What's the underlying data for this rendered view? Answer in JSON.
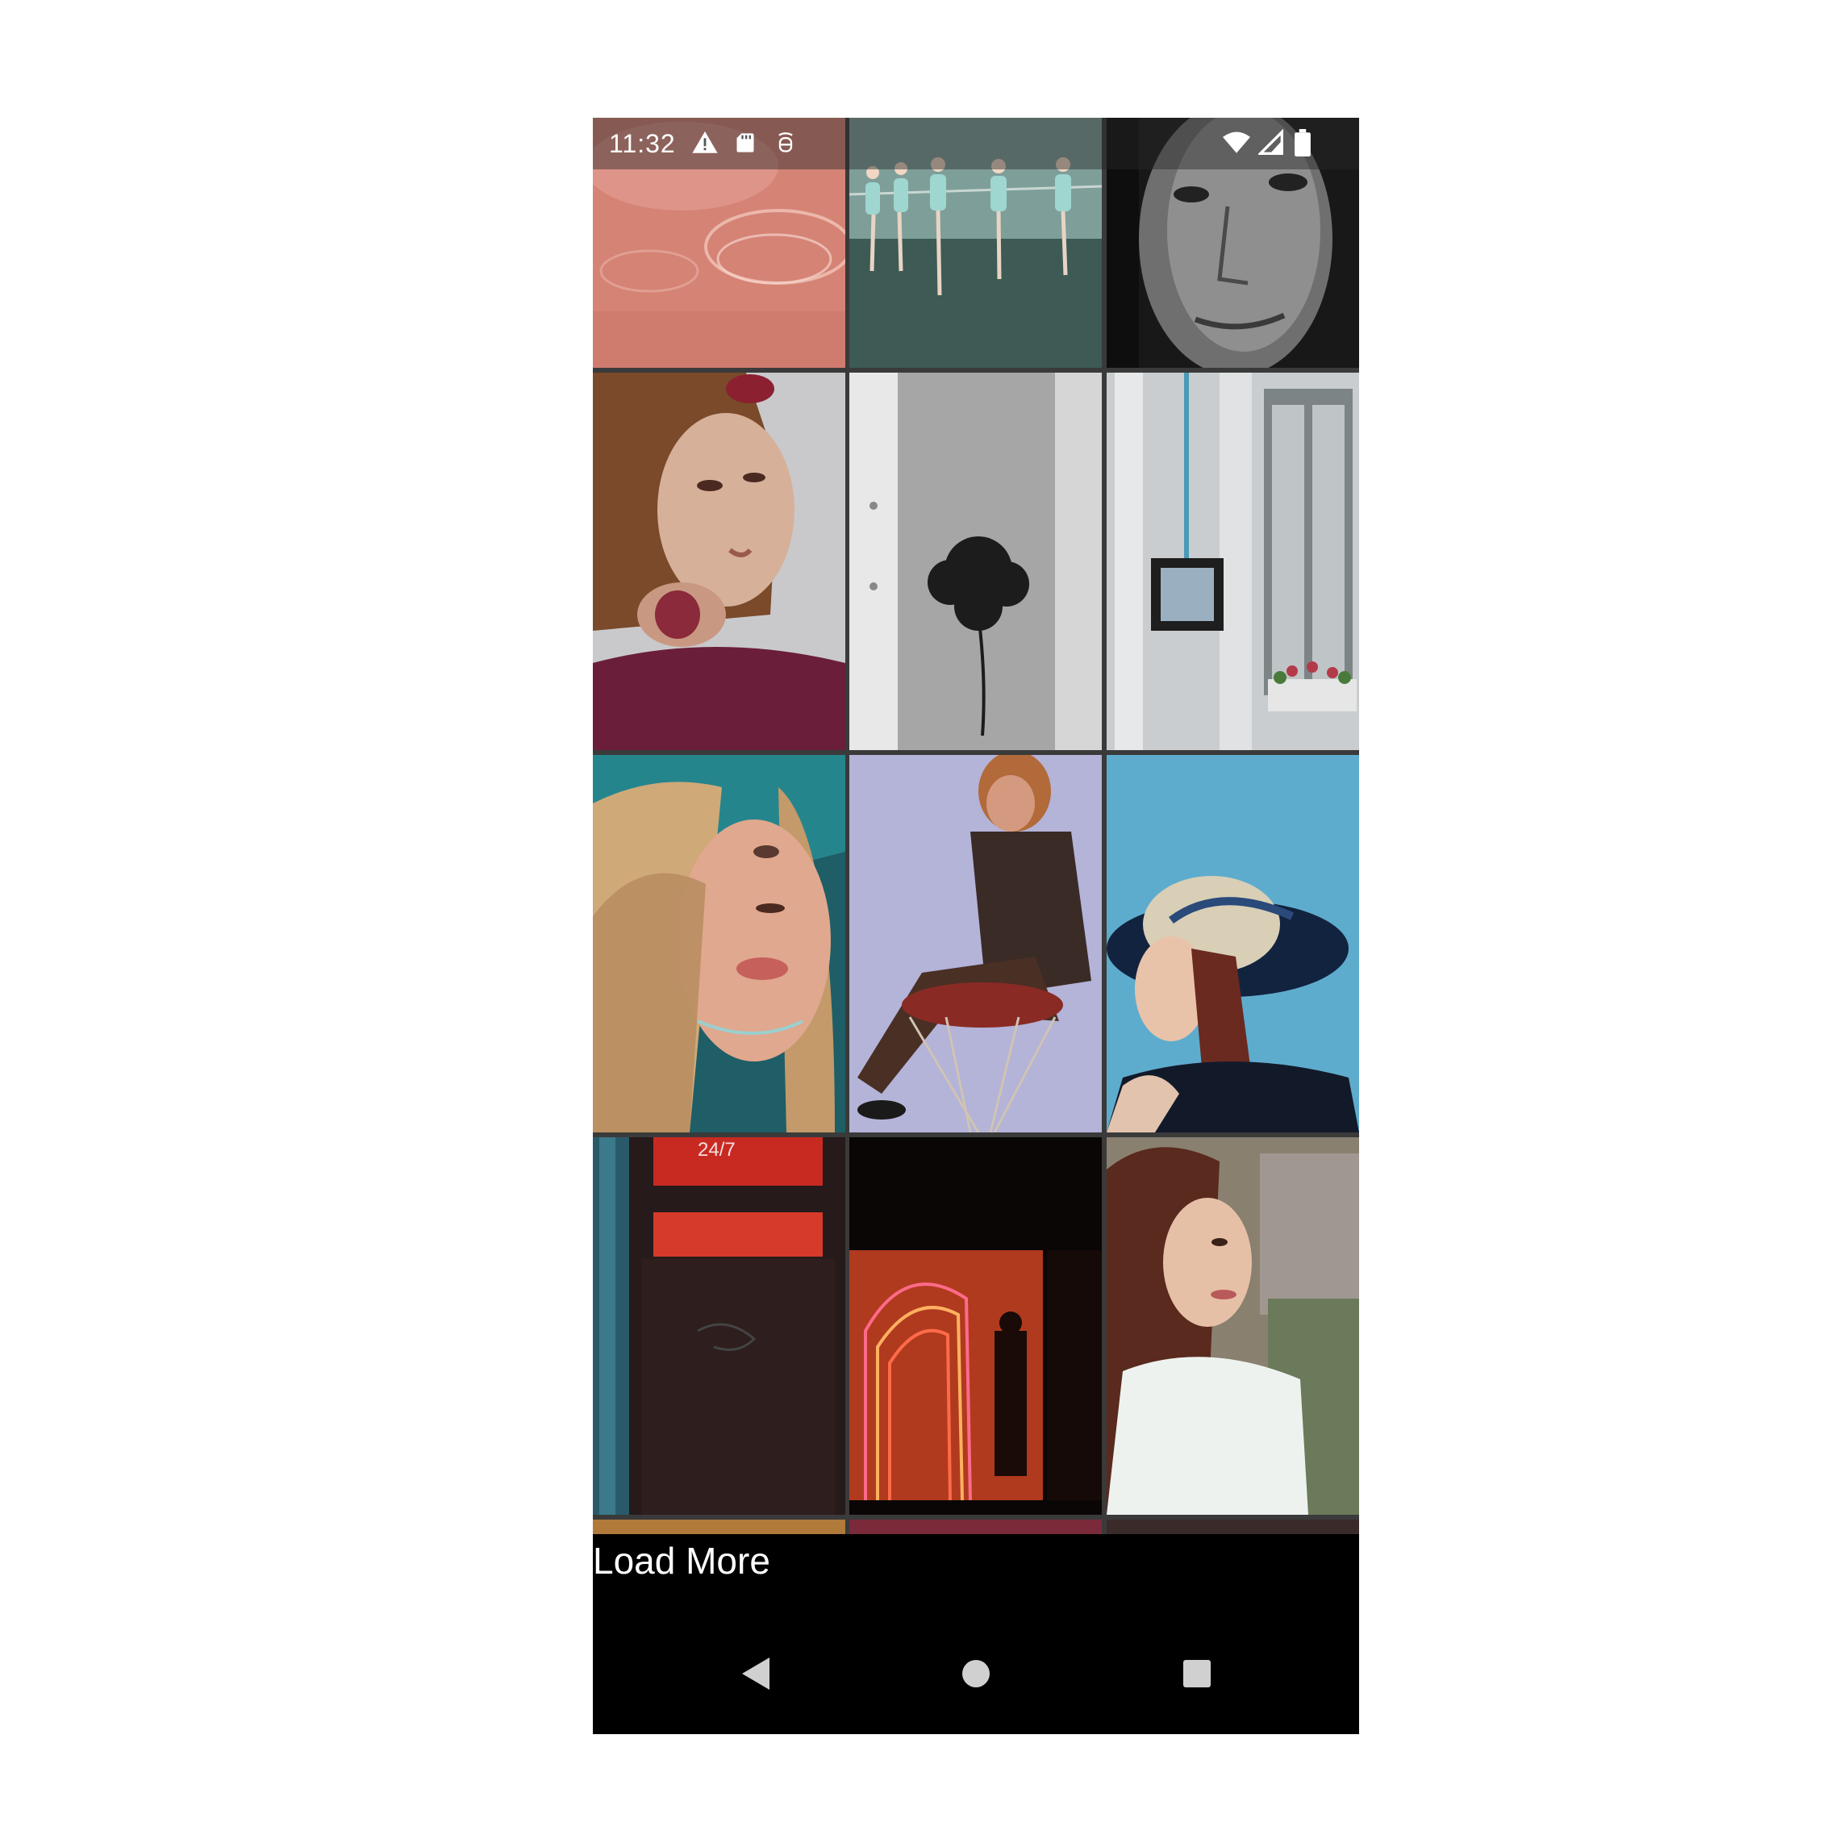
{
  "status_bar": {
    "time": "11:32",
    "left_icons": [
      "warning-icon",
      "sd-card-icon",
      "recording-icon"
    ],
    "right_icons": [
      "wifi-icon",
      "cellular-signal-icon",
      "battery-icon"
    ]
  },
  "gallery": {
    "columns": 3,
    "photos": [
      {
        "subject": "glassware on pink fabric",
        "palette": [
          "#d9877a",
          "#e6a79a"
        ]
      },
      {
        "subject": "ballet dancers at barre",
        "palette": [
          "#5f7f79",
          "#8fb4ad"
        ]
      },
      {
        "subject": "black and white portrait",
        "palette": [
          "#1b1b1b",
          "#8a8a8a"
        ]
      },
      {
        "subject": "woman with flowers in hair",
        "palette": [
          "#5d3032",
          "#c7a695"
        ]
      },
      {
        "subject": "black flower on skin",
        "palette": [
          "#404040",
          "#bdbdbd"
        ]
      },
      {
        "subject": "white building facade",
        "palette": [
          "#9ea6a8",
          "#d4d7d8"
        ]
      },
      {
        "subject": "woman with blonde wavy hair",
        "palette": [
          "#2d8a8a",
          "#d0a07e"
        ]
      },
      {
        "subject": "man sitting on basketball hoop",
        "palette": [
          "#a9a9d2",
          "#4a3226"
        ]
      },
      {
        "subject": "woman in wide brim hat",
        "palette": [
          "#5ea6c9",
          "#1a2a4a"
        ]
      },
      {
        "subject": "neon sign 24/7 doorway",
        "palette": [
          "#2a1616",
          "#c83a2a"
        ]
      },
      {
        "subject": "neon arches storefront",
        "palette": [
          "#0a0605",
          "#e0502a"
        ]
      },
      {
        "subject": "woman in white top",
        "palette": [
          "#7a6a5a",
          "#e8ece9"
        ]
      }
    ]
  },
  "load_more": {
    "label": "Load More"
  },
  "nav_bar": {
    "buttons": [
      "back-icon",
      "home-icon",
      "recents-icon"
    ]
  }
}
